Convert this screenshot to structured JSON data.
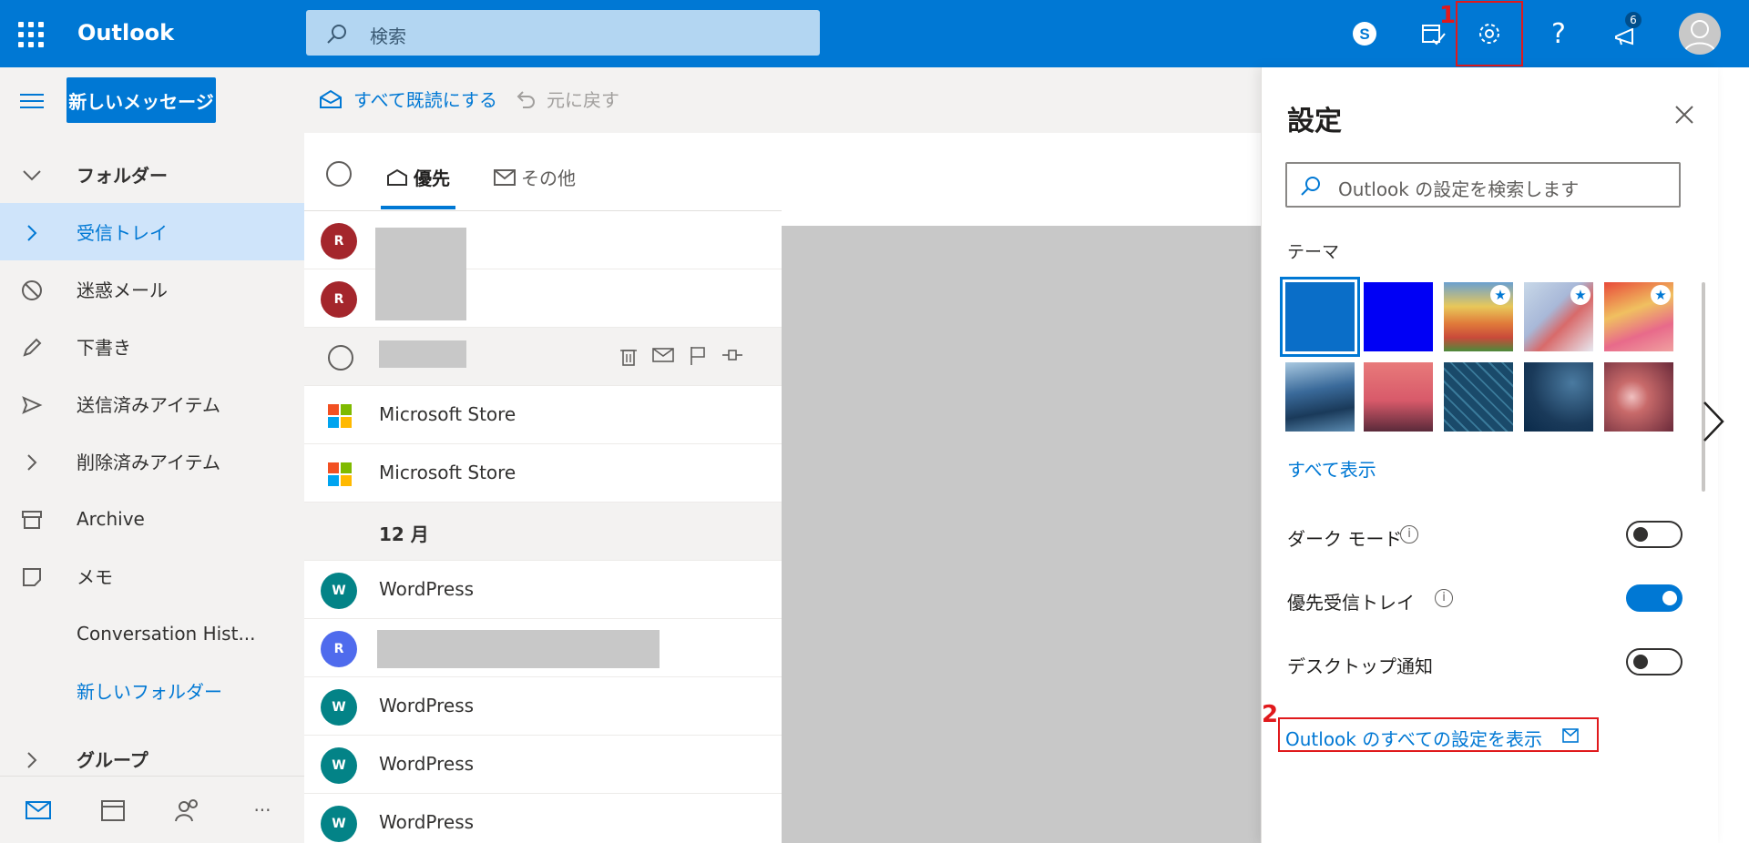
{
  "topbar": {
    "app_name": "Outlook",
    "search_placeholder": "検索",
    "notification_count": "6",
    "step1": "1"
  },
  "leftnav": {
    "new_message": "新しいメッセージ",
    "items": [
      {
        "label": "フォルダー",
        "icon": "chevron-down-icon"
      },
      {
        "label": "受信トレイ",
        "icon": "chevron-right-icon"
      },
      {
        "label": "迷惑メール",
        "icon": "blocked-icon"
      },
      {
        "label": "下書き",
        "icon": "pencil-icon"
      },
      {
        "label": "送信済みアイテム",
        "icon": "send-icon"
      },
      {
        "label": "削除済みアイテム",
        "icon": "chevron-right-icon"
      },
      {
        "label": "Archive",
        "icon": "archive-icon"
      },
      {
        "label": "メモ",
        "icon": "note-icon"
      },
      {
        "label": "Conversation Hist..."
      },
      {
        "label": "新しいフォルダー"
      },
      {
        "label": "グループ",
        "icon": "chevron-right-icon"
      }
    ],
    "bottom_more": "···"
  },
  "commands": {
    "mark_all_read": "すべて既読にする",
    "undo": "元に戻す"
  },
  "list": {
    "tab_focused": "優先",
    "tab_other": "その他",
    "rows": [
      {
        "avatar": "R",
        "sender": ""
      },
      {
        "avatar": "R",
        "sender": ""
      },
      {
        "avatar": "",
        "sender": ""
      },
      {
        "sender": "Microsoft Store"
      },
      {
        "sender": "Microsoft Store"
      },
      {
        "date": "12 月"
      },
      {
        "avatar": "W",
        "sender": "WordPress"
      },
      {
        "avatar": "R",
        "sender": ""
      },
      {
        "avatar": "W",
        "sender": "WordPress"
      },
      {
        "avatar": "W",
        "sender": "WordPress"
      },
      {
        "avatar": "W",
        "sender": "WordPress"
      }
    ]
  },
  "settings": {
    "title": "設定",
    "search_placeholder": "Outlook の設定を検索します",
    "theme_label": "テーマ",
    "show_all": "すべて表示",
    "dark_mode": "ダーク モード",
    "focused_inbox": "優先受信トレイ",
    "desktop_notifications": "デスクトップ通知",
    "dark_mode_on": false,
    "focused_inbox_on": true,
    "desktop_notifications_on": false,
    "all_settings_link": "Outlook のすべての設定を表示",
    "step2": "2"
  },
  "colors": {
    "brand": "#0078d4",
    "highlight": "#e0191c",
    "avatar_red": "#a4262c",
    "avatar_teal": "#038387",
    "avatar_blue": "#4f6bed"
  }
}
